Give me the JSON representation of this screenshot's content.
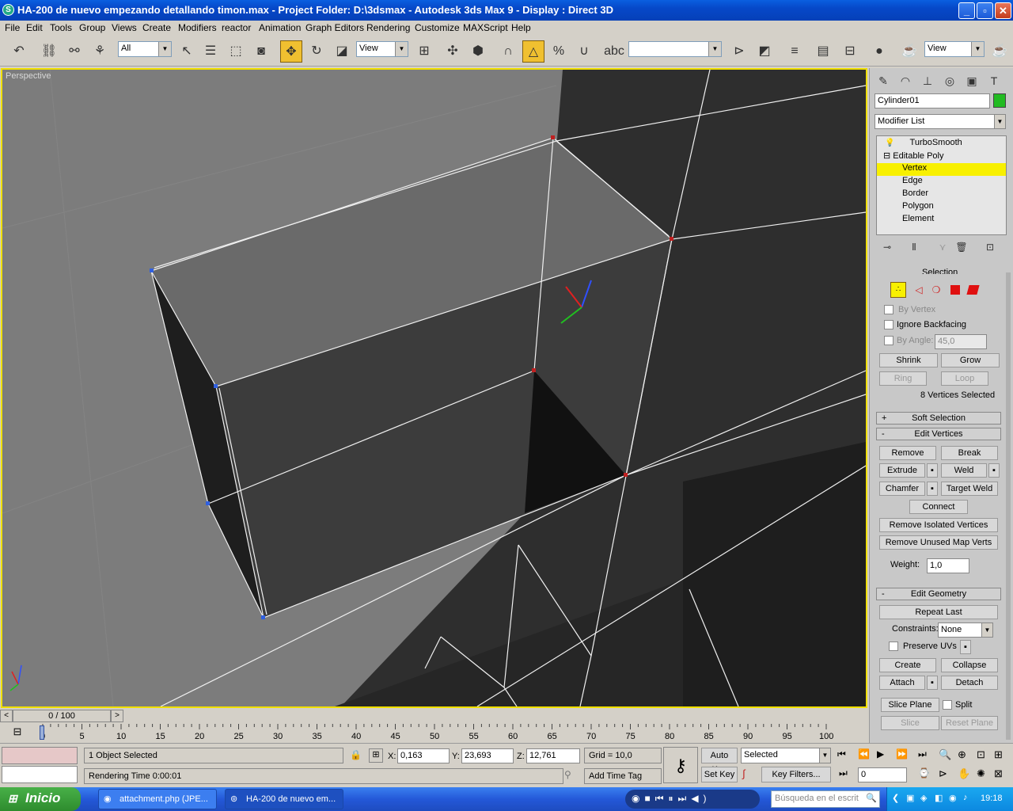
{
  "window": {
    "title": "HA-200 de nuevo empezando detallando timon.max    - Project Folder: D:\\3dsmax    - Autodesk 3ds Max 9    - Display : Direct 3D"
  },
  "menu": [
    "File",
    "Edit",
    "Tools",
    "Group",
    "Views",
    "Create",
    "Modifiers",
    "reactor",
    "Animation",
    "Graph Editors",
    "Rendering",
    "Customize",
    "MAXScript",
    "Help"
  ],
  "toolbar": {
    "selection_filter": "All",
    "ref_coord": "View",
    "named_sel": "",
    "render_view": "View"
  },
  "viewport": {
    "label": "Perspective"
  },
  "panel": {
    "object_name": "Cylinder01",
    "object_color": "#22bb22",
    "modifier_list": "Modifier List",
    "stack": [
      {
        "label": "TurboSmooth"
      },
      {
        "label": "Editable Poly"
      },
      {
        "label": "Vertex"
      },
      {
        "label": "Edge"
      },
      {
        "label": "Border"
      },
      {
        "label": "Polygon"
      },
      {
        "label": "Element"
      }
    ],
    "selection": {
      "title": "Selection",
      "by_vertex": "By Vertex",
      "ignore_backfacing": "Ignore Backfacing",
      "by_angle": "By Angle:",
      "angle_value": "45,0",
      "shrink": "Shrink",
      "grow": "Grow",
      "ring": "Ring",
      "loop": "Loop",
      "status": "8 Vertices Selected"
    },
    "soft_selection": "Soft Selection",
    "edit_vertices": {
      "title": "Edit Vertices",
      "remove": "Remove",
      "break": "Break",
      "extrude": "Extrude",
      "weld": "Weld",
      "chamfer": "Chamfer",
      "target_weld": "Target Weld",
      "connect": "Connect",
      "remove_isolated": "Remove Isolated Vertices",
      "remove_unused": "Remove Unused Map Verts",
      "weight_label": "Weight:",
      "weight_value": "1,0"
    },
    "edit_geometry": {
      "title": "Edit Geometry",
      "repeat_last": "Repeat Last",
      "constraints_label": "Constraints:",
      "constraints_value": "None",
      "preserve_uvs": "Preserve UVs",
      "create": "Create",
      "collapse": "Collapse",
      "attach": "Attach",
      "detach": "Detach",
      "slice_plane": "Slice Plane",
      "split": "Split",
      "slice": "Slice",
      "reset_plane": "Reset Plane"
    }
  },
  "timeline": {
    "frame": "0 / 100",
    "ticks": [
      "0",
      "5",
      "10",
      "15",
      "20",
      "25",
      "30",
      "35",
      "40",
      "45",
      "50",
      "55",
      "60",
      "65",
      "70",
      "75",
      "80",
      "85",
      "90",
      "95",
      "100"
    ]
  },
  "status": {
    "selected": "1 Object Selected",
    "rendering_time": "Rendering Time  0:00:01",
    "x_label": "X:",
    "x": "0,163",
    "y_label": "Y:",
    "y": "23,693",
    "z_label": "Z:",
    "z": "12,761",
    "grid": "Grid = 10,0",
    "add_time_tag": "Add Time Tag",
    "auto_key": "Auto Key",
    "set_key": "Set Key",
    "key_mode": "Selected",
    "key_filters": "Key Filters...",
    "current_frame": "0"
  },
  "taskbar": {
    "start": "Inicio",
    "tasks": [
      "attachment.php (JPE...",
      "HA-200 de nuevo em..."
    ],
    "search_placeholder": "Búsqueda en el escrit",
    "clock": "19:18"
  }
}
